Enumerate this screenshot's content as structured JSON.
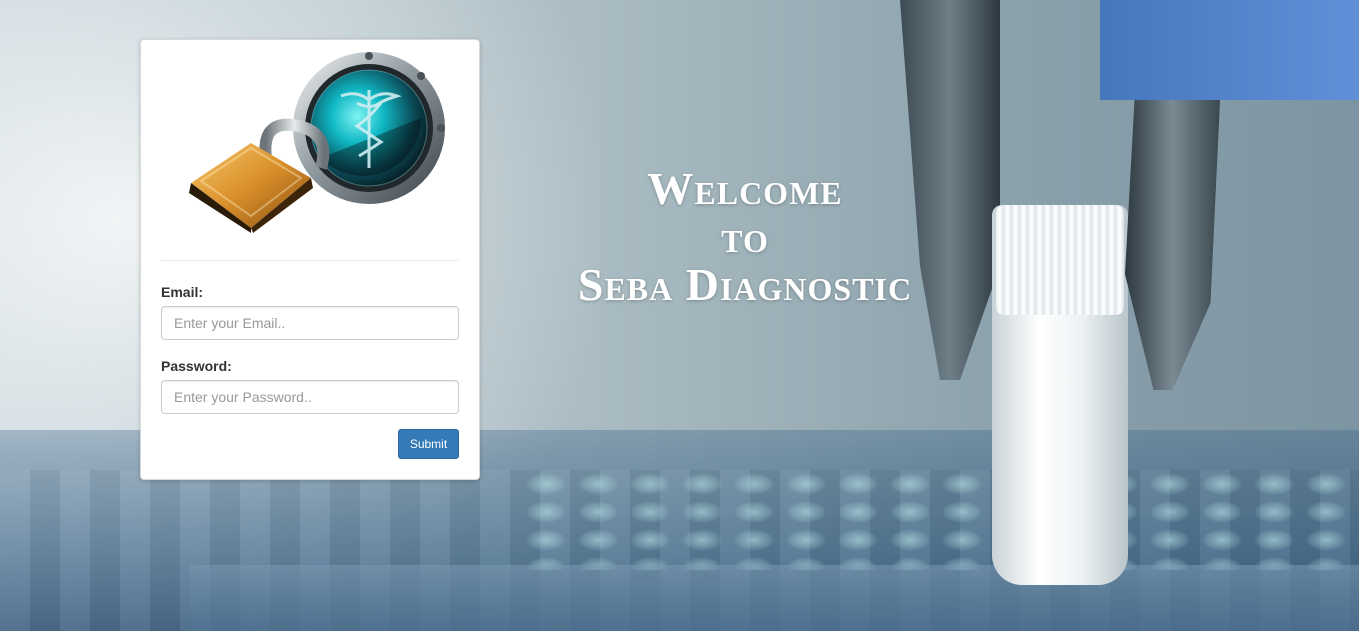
{
  "welcome": {
    "line1": "Welcome",
    "line2": "to",
    "line3": "Seba Diagnostic"
  },
  "login": {
    "email_label": "Email:",
    "email_placeholder": "Enter your Email..",
    "email_value": "",
    "password_label": "Password:",
    "password_placeholder": "Enter your Password..",
    "password_value": "",
    "submit_label": "Submit",
    "logo_icon": "medical-padlock-logo"
  },
  "colors": {
    "submit_bg": "#337ab7",
    "card_bg": "#ffffff",
    "welcome_text": "#ffffff"
  }
}
